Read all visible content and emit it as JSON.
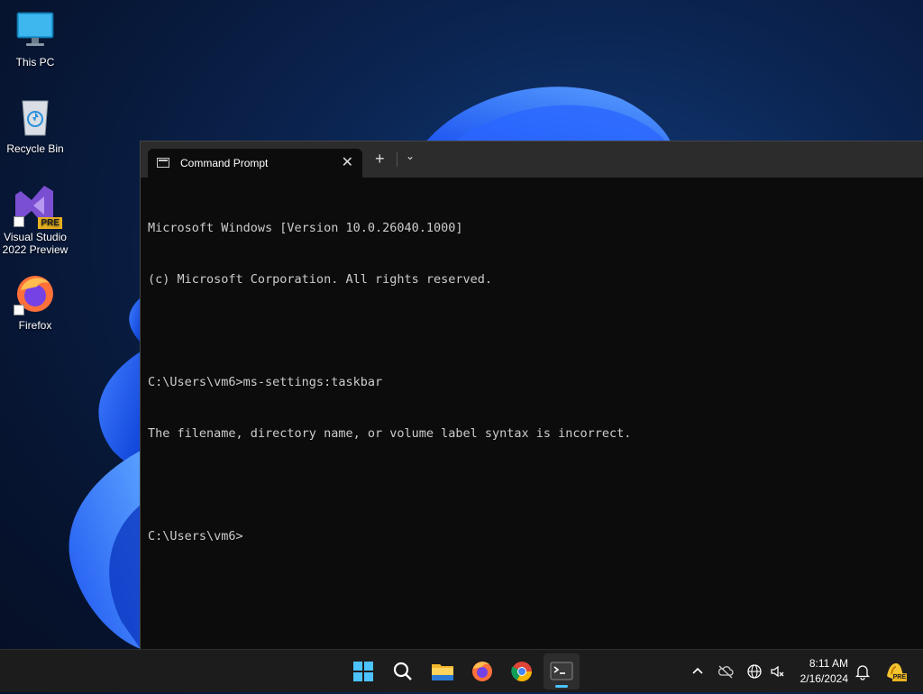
{
  "desktop": {
    "icons": [
      {
        "label": "This PC",
        "icon": "monitor-icon"
      },
      {
        "label": "Recycle Bin",
        "icon": "recycle-bin-icon"
      },
      {
        "label": "Visual Studio\n2022 Preview",
        "label_line1": "Visual Studio",
        "label_line2": "2022 Preview",
        "icon": "visual-studio-icon",
        "badge": "PRE"
      },
      {
        "label": "Firefox",
        "icon": "firefox-icon"
      }
    ]
  },
  "terminal": {
    "tab_title": "Command Prompt",
    "close_glyph": "✕",
    "new_tab_glyph": "+",
    "dropdown_glyph": "⌄",
    "lines": [
      "Microsoft Windows [Version 10.0.26040.1000]",
      "(c) Microsoft Corporation. All rights reserved.",
      "",
      "C:\\Users\\vm6>ms-settings:taskbar",
      "The filename, directory name, or volume label syntax is incorrect.",
      "",
      "C:\\Users\\vm6>"
    ]
  },
  "taskbar": {
    "apps": [
      "start-icon",
      "search-icon",
      "file-explorer-icon",
      "firefox-icon",
      "chrome-icon",
      "terminal-icon"
    ],
    "tray": {
      "time": "8:11 AM",
      "date": "2/16/2024",
      "badge": "PRE"
    }
  },
  "colors": {
    "accent": "#4cc2ff",
    "terminal_bg": "#0c0c0c",
    "terminal_fg": "#cccccc",
    "taskbar_bg": "#1c1c1c"
  }
}
